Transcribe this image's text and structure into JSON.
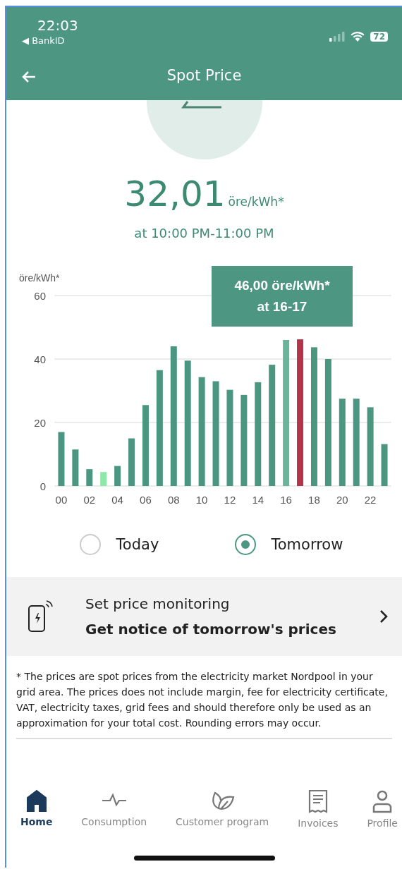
{
  "status_bar": {
    "time": "22:03",
    "back_app": "◀ BankID",
    "battery": "72"
  },
  "header": {
    "title": "Spot Price"
  },
  "price": {
    "value": "32,01",
    "unit": "öre/kWh*",
    "period": "at 10:00 PM-11:00 PM"
  },
  "chart": {
    "tooltip": {
      "line_1": "46,00 öre/kWh*",
      "line_2": "at 16-17"
    },
    "chart_data": {
      "type": "bar",
      "ylabel": "öre/kWh*",
      "x": [
        0,
        1,
        2,
        3,
        4,
        5,
        6,
        7,
        8,
        9,
        10,
        11,
        12,
        13,
        14,
        15,
        16,
        17,
        18,
        19,
        20,
        21,
        22,
        23
      ],
      "xticks": [
        {
          "value": 0,
          "label": "00"
        },
        {
          "value": 2,
          "label": "02"
        },
        {
          "value": 4,
          "label": "04"
        },
        {
          "value": 6,
          "label": "06"
        },
        {
          "value": 8,
          "label": "08"
        },
        {
          "value": 10,
          "label": "10"
        },
        {
          "value": 12,
          "label": "12"
        },
        {
          "value": 14,
          "label": "14"
        },
        {
          "value": 16,
          "label": "16"
        },
        {
          "value": 18,
          "label": "18"
        },
        {
          "value": 20,
          "label": "20"
        },
        {
          "value": 22,
          "label": "22"
        }
      ],
      "yticks": [
        0,
        20,
        40,
        60
      ],
      "ylim": [
        0,
        60
      ],
      "xlim": [
        -0.5,
        23.5
      ],
      "series": [
        {
          "color": "#4b9680",
          "values": [
            17,
            11.5,
            5.3,
            null,
            6.3,
            15,
            25.5,
            36.5,
            44,
            39.5,
            34.3,
            33,
            30.3,
            28.7,
            32.7,
            38.2,
            null,
            null,
            43.7,
            40,
            27.5,
            27.5,
            24.8,
            13.2
          ]
        },
        {
          "color": "#8ee8a8",
          "values": [
            null,
            null,
            null,
            4.4,
            null,
            null,
            null,
            null,
            null,
            null,
            null,
            null,
            null,
            null,
            null,
            null,
            null,
            null,
            null,
            null,
            null,
            null,
            null,
            null
          ]
        },
        {
          "color": "#6cb39c",
          "values": [
            null,
            null,
            null,
            null,
            null,
            null,
            null,
            null,
            null,
            null,
            null,
            null,
            null,
            null,
            null,
            null,
            46,
            null,
            null,
            null,
            null,
            null,
            null,
            null
          ]
        },
        {
          "color": "#b3354b",
          "values": [
            null,
            null,
            null,
            null,
            null,
            null,
            null,
            null,
            null,
            null,
            null,
            null,
            null,
            null,
            null,
            null,
            null,
            46.2,
            null,
            null,
            null,
            null,
            null,
            null
          ]
        }
      ]
    }
  },
  "day_options": [
    {
      "label": "Today",
      "selected": false
    },
    {
      "label": "Tomorrow",
      "selected": true
    }
  ],
  "monitoring": {
    "title": "Set price monitoring",
    "subtitle": "Get notice of tomorrow's prices"
  },
  "footnote": "* The prices are spot prices from the electricity market Nordpool in your grid area. The prices does not include margin, fee for electricity certificate, VAT, electricity taxes, grid fees and should therefore only be used as an approximation for your total cost. Rounding errors may occur.",
  "tab_bar": [
    {
      "label": "Home",
      "kind": "home",
      "selected": true
    },
    {
      "label": "Consumption",
      "kind": "pulse",
      "selected": false
    },
    {
      "label": "Customer program",
      "kind": "leaf",
      "selected": false
    },
    {
      "label": "Invoices",
      "kind": "receipt",
      "selected": false
    },
    {
      "label": "Profile",
      "kind": "person",
      "selected": false
    }
  ]
}
